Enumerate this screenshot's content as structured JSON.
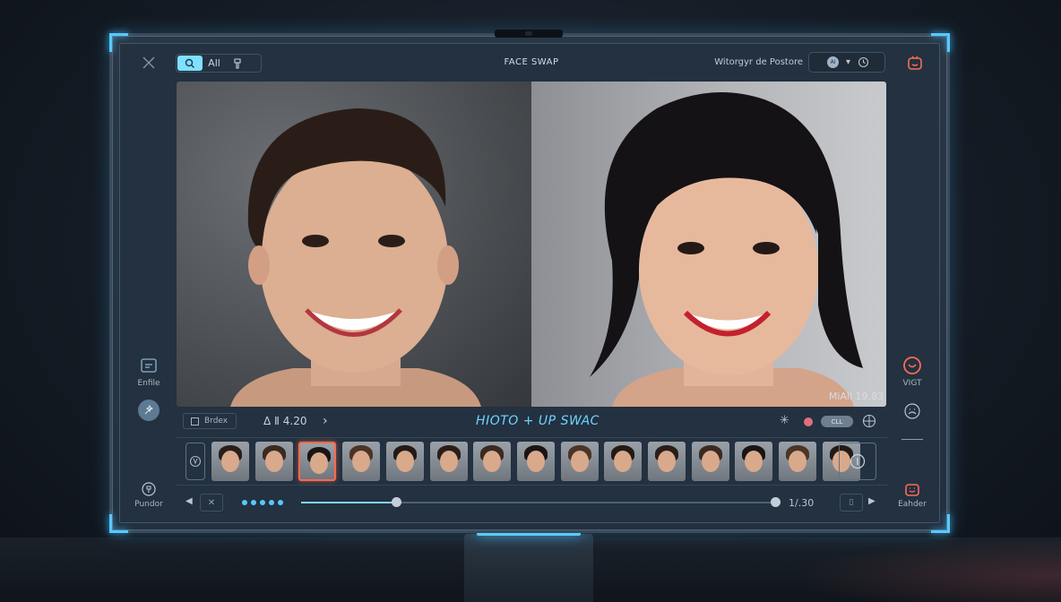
{
  "app": {
    "title": "FACE SWAP",
    "status_text": "Witorgyr de Postore"
  },
  "toolbar": {
    "tools": [
      {
        "icon": "search-icon",
        "label": "",
        "active": true
      },
      {
        "icon": "text-icon",
        "label": "All",
        "active": false
      },
      {
        "icon": "brush-icon",
        "label": "",
        "active": false
      }
    ]
  },
  "top_controls": {
    "dot_label": "AI",
    "dropdown": "▾"
  },
  "photos": {
    "overlay_label": "MiAll 19.83"
  },
  "left_panel": {
    "items": [
      {
        "icon": "edit-icon",
        "label": "Enfile"
      },
      {
        "icon": "magic-icon",
        "label": ""
      },
      {
        "icon": "paint-icon",
        "label": "Pundor"
      }
    ]
  },
  "right_panel": {
    "items": [
      {
        "icon": "target-icon",
        "label": "VIGT"
      },
      {
        "icon": "face-icon",
        "label": ""
      },
      {
        "icon": "robot-icon",
        "label": "Eahder"
      }
    ]
  },
  "mid_toolbar": {
    "view_label": "Brdex",
    "zoom_text": "Δ Ⅱ 4.20",
    "mode_title": "HIOTO + UP SWAC",
    "pill_label": "CLL"
  },
  "filmstrip": {
    "selected_index": 2,
    "thumb_count": 15
  },
  "playback": {
    "time": "1/.30",
    "progress": 0.2,
    "end_position": 1.0
  },
  "colors": {
    "accent": "#5ac8ff",
    "mode_title": "#6fd3ff",
    "selected_thumb": "#ff6a4d",
    "record": "#e0707a"
  }
}
